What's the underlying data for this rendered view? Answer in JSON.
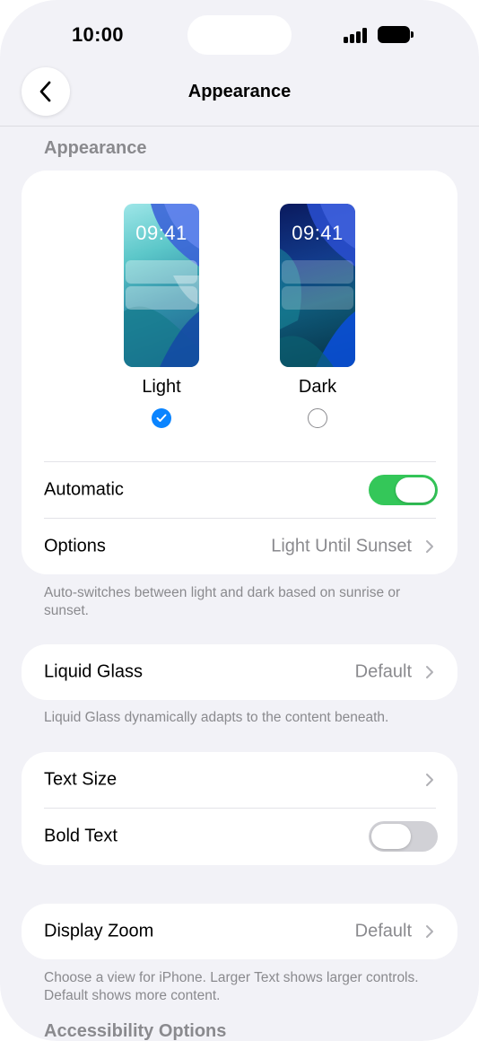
{
  "status_bar": {
    "time": "10:00"
  },
  "nav": {
    "title": "Appearance"
  },
  "appearance": {
    "section_title": "Appearance",
    "themes": [
      {
        "name": "Light",
        "preview_time": "09:41",
        "selected": true
      },
      {
        "name": "Dark",
        "preview_time": "09:41",
        "selected": false
      }
    ],
    "automatic": {
      "label": "Automatic",
      "enabled": true
    },
    "options": {
      "label": "Options",
      "value": "Light Until Sunset"
    },
    "footer": "Auto-switches between light and dark based on sunrise or sunset."
  },
  "liquid_glass": {
    "label": "Liquid Glass",
    "value": "Default",
    "footer": "Liquid Glass dynamically adapts to the content beneath."
  },
  "text": {
    "text_size": {
      "label": "Text Size"
    },
    "bold_text": {
      "label": "Bold Text",
      "enabled": false
    }
  },
  "display_zoom": {
    "label": "Display Zoom",
    "value": "Default",
    "footer": "Choose a view for iPhone. Larger Text shows larger controls. Default shows more content."
  },
  "accessibility": {
    "section_title": "Accessibility Options"
  },
  "colors": {
    "accent": "#0a84ff",
    "toggle_on": "#34c759",
    "toggle_off": "#d1d1d6",
    "background": "#f2f2f7",
    "secondary_text": "#8a8a8e"
  }
}
